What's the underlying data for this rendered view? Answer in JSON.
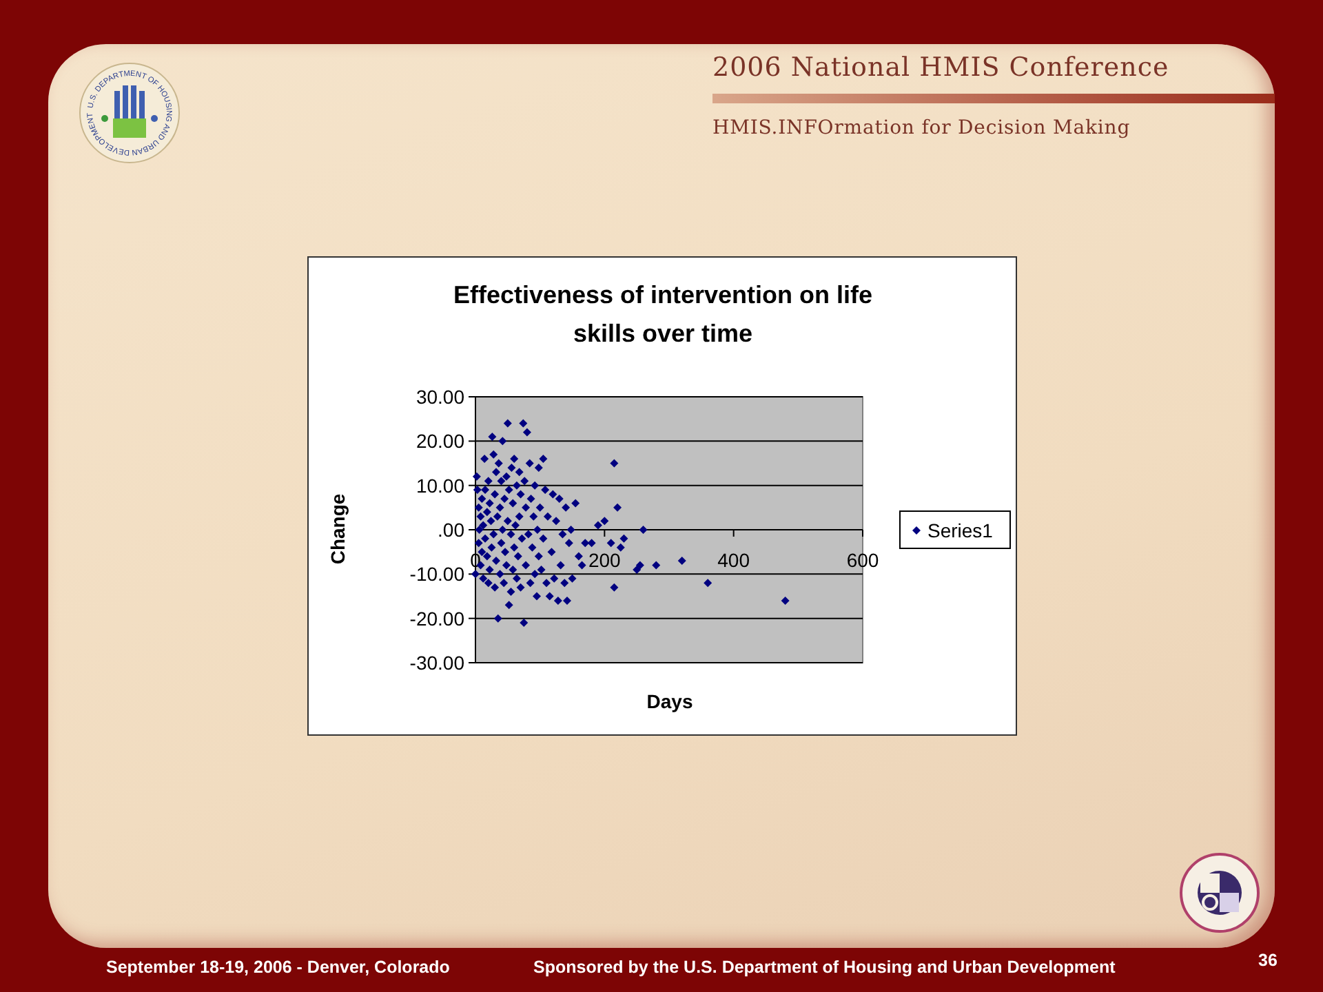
{
  "header": {
    "seal_text": "U.S. DEPARTMENT OF HOUSING AND URBAN DEVELOPMENT",
    "title": "2006 National HMIS Conference",
    "subtitle": "HMIS.INFOrmation for Decision Making"
  },
  "chart": {
    "chart_data": {
      "type": "scatter",
      "title": "Effectiveness of intervention on life skills over time",
      "xlabel": "Days",
      "ylabel": "Change",
      "x": [
        0,
        2,
        3,
        5,
        5,
        6,
        8,
        8,
        10,
        10,
        12,
        12,
        14,
        15,
        15,
        18,
        18,
        20,
        20,
        22,
        22,
        24,
        25,
        26,
        28,
        28,
        30,
        30,
        32,
        32,
        34,
        35,
        36,
        38,
        38,
        40,
        40,
        42,
        42,
        44,
        45,
        46,
        48,
        48,
        50,
        50,
        52,
        52,
        55,
        55,
        56,
        58,
        58,
        60,
        60,
        62,
        64,
        64,
        66,
        68,
        68,
        70,
        70,
        72,
        74,
        75,
        76,
        78,
        78,
        80,
        82,
        84,
        85,
        86,
        88,
        90,
        92,
        92,
        95,
        96,
        98,
        98,
        100,
        102,
        105,
        105,
        108,
        110,
        112,
        115,
        118,
        120,
        122,
        125,
        128,
        130,
        132,
        135,
        138,
        140,
        142,
        145,
        148,
        150,
        155,
        160,
        165,
        170,
        180,
        190,
        200,
        210,
        215,
        215,
        220,
        225,
        230,
        250,
        255,
        260,
        280,
        320,
        360,
        480
      ],
      "series": [
        {
          "name": "Series1",
          "color": "#000080",
          "values": [
            -10,
            12,
            9,
            5,
            -3,
            0,
            -8,
            3,
            7,
            -5,
            -11,
            1,
            16,
            -2,
            9,
            -6,
            4,
            -12,
            11,
            6,
            -9,
            2,
            -4,
            21,
            17,
            -1,
            8,
            -13,
            -7,
            13,
            3,
            -20,
            15,
            -10,
            5,
            -3,
            11,
            20,
            0,
            -12,
            7,
            -5,
            12,
            -8,
            2,
            24,
            -17,
            9,
            -14,
            -1,
            14,
            6,
            -9,
            -4,
            16,
            1,
            10,
            -11,
            -6,
            13,
            3,
            -13,
            8,
            -2,
            24,
            -21,
            11,
            5,
            -8,
            22,
            -1,
            15,
            -12,
            7,
            -4,
            3,
            -10,
            10,
            -15,
            0,
            14,
            -6,
            5,
            -9,
            16,
            -2,
            9,
            -12,
            3,
            -15,
            -5,
            8,
            -11,
            2,
            -16,
            7,
            -8,
            -1,
            -12,
            5,
            -16,
            -3,
            0,
            -11,
            6,
            -6,
            -8,
            -3,
            -3,
            1,
            2,
            -3,
            15,
            -13,
            5,
            -4,
            -2,
            -9,
            -8,
            0,
            -8,
            -7,
            -12,
            -16
          ]
        }
      ],
      "grid": true,
      "xlim": [
        0,
        600
      ],
      "ylim": [
        -30,
        30
      ],
      "xticks": [
        0,
        200,
        400,
        600
      ],
      "yticks": [
        {
          "value": 30,
          "label": "30.00"
        },
        {
          "value": 20,
          "label": "20.00"
        },
        {
          "value": 10,
          "label": "10.00"
        },
        {
          "value": 0,
          "label": ".00"
        },
        {
          "value": -10,
          "label": "-10.00"
        },
        {
          "value": -20,
          "label": "-20.00"
        },
        {
          "value": -30,
          "label": "-30.00"
        }
      ]
    }
  },
  "footer": {
    "event": "September 18-19, 2006 - Denver, Colorado",
    "sponsor": "Sponsored by the U.S. Department of Housing and Urban Development",
    "page_number": "36"
  }
}
